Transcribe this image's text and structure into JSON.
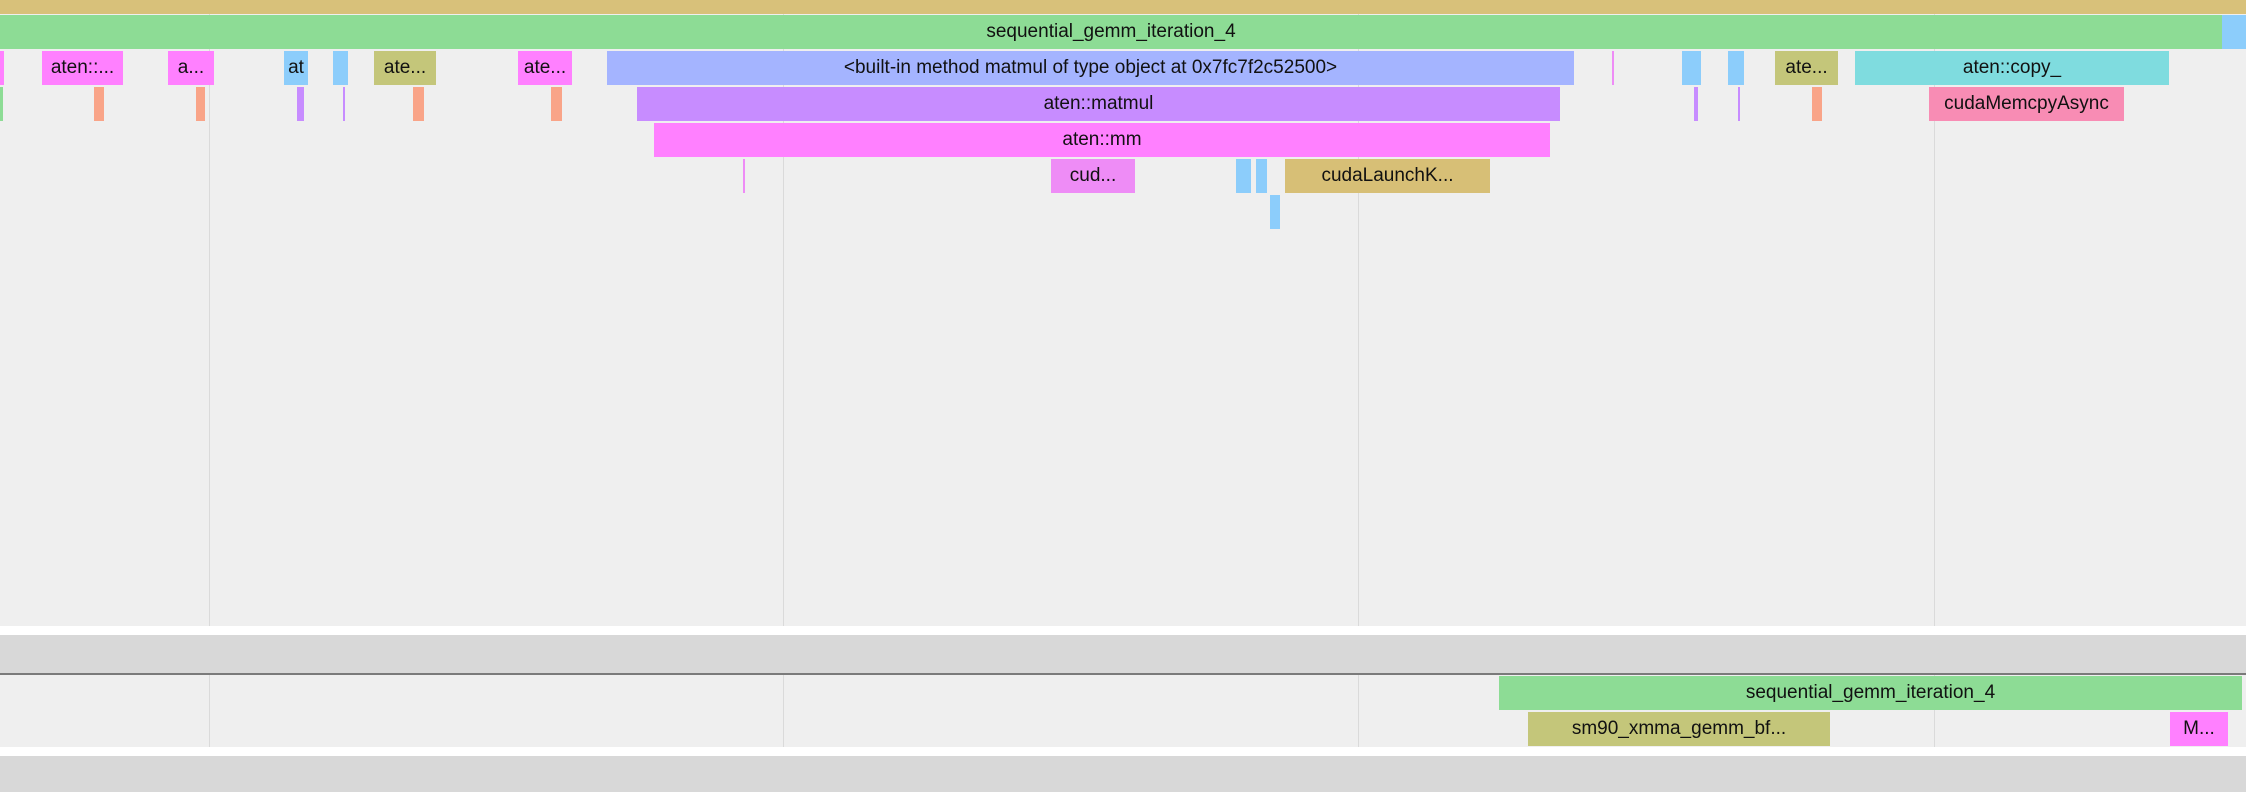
{
  "colors": {
    "background": "#efefef",
    "separator": "#d8d8d8",
    "divider_line": "#7a7a7a",
    "green": "#8ddc95",
    "tan_top": "#d8c17a",
    "pink": "#ff80ff",
    "violet": "#c78cff",
    "magenta_light": "#ee8cf6",
    "lavender_blue": "#a4b4ff",
    "sky": "#8ccdfb",
    "olive": "#c4c67a",
    "gold": "#d7bf76",
    "salmon": "#f9a488",
    "teal": "#7fdcdf",
    "rose": "#f88cb4"
  },
  "cpu_track": {
    "events": [
      {
        "name": "top-bar",
        "label": "",
        "color": "tan_top"
      },
      {
        "name": "sequential-gemm-iteration-4-bar",
        "label": "sequential_gemm_iteration_4",
        "color": "green"
      },
      {
        "name": "right-edge-sky-bar",
        "label": "",
        "color": "sky"
      },
      {
        "name": "left-edge-pink-bar",
        "label": "",
        "color": "pink"
      },
      {
        "name": "aten-bar-1",
        "label": "aten::...",
        "color": "pink"
      },
      {
        "name": "aten-bar-2",
        "label": "a...",
        "color": "pink"
      },
      {
        "name": "at-bar",
        "label": "at",
        "color": "sky"
      },
      {
        "name": "small-sky-bar-1",
        "label": "",
        "color": "sky"
      },
      {
        "name": "ate-bar-1",
        "label": "ate...",
        "color": "olive"
      },
      {
        "name": "ate-bar-2",
        "label": "ate...",
        "color": "pink"
      },
      {
        "name": "builtin-matmul-bar",
        "label": "<built-in method matmul of type object at 0x7fc7f2c52500>",
        "color": "lavender_blue"
      },
      {
        "name": "thin-magenta-tick-1",
        "label": "",
        "color": "magenta_light"
      },
      {
        "name": "small-sky-bar-2",
        "label": "",
        "color": "sky"
      },
      {
        "name": "small-sky-bar-3",
        "label": "",
        "color": "sky"
      },
      {
        "name": "ate-bar-3",
        "label": "ate...",
        "color": "olive"
      },
      {
        "name": "aten-copy-bar",
        "label": "aten::copy_",
        "color": "teal"
      },
      {
        "name": "green-tick-left",
        "label": "",
        "color": "green"
      },
      {
        "name": "salmon-tick-1",
        "label": "",
        "color": "salmon"
      },
      {
        "name": "salmon-tick-2",
        "label": "",
        "color": "salmon"
      },
      {
        "name": "violet-tick-1",
        "label": "",
        "color": "violet"
      },
      {
        "name": "violet-tick-2",
        "label": "",
        "color": "violet"
      },
      {
        "name": "salmon-tick-3",
        "label": "",
        "color": "salmon"
      },
      {
        "name": "salmon-tick-4",
        "label": "",
        "color": "salmon"
      },
      {
        "name": "aten-matmul-bar",
        "label": "aten::matmul",
        "color": "violet"
      },
      {
        "name": "violet-tick-3",
        "label": "",
        "color": "violet"
      },
      {
        "name": "violet-tick-4",
        "label": "",
        "color": "violet"
      },
      {
        "name": "salmon-tick-5",
        "label": "",
        "color": "salmon"
      },
      {
        "name": "cuda-memcpy-async-bar",
        "label": "cudaMemcpyAsync",
        "color": "rose"
      },
      {
        "name": "aten-mm-bar",
        "label": "aten::mm",
        "color": "pink"
      },
      {
        "name": "thin-magenta-tick-2",
        "label": "",
        "color": "magenta_light"
      },
      {
        "name": "cud-bar",
        "label": "cud...",
        "color": "magenta_light"
      },
      {
        "name": "small-sky-bar-4",
        "label": "",
        "color": "sky"
      },
      {
        "name": "small-sky-bar-5",
        "label": "",
        "color": "sky"
      },
      {
        "name": "cuda-launch-kernel-bar",
        "label": "cudaLaunchK...",
        "color": "gold"
      },
      {
        "name": "small-sky-bar-6",
        "label": "",
        "color": "sky"
      }
    ]
  },
  "gpu_track": {
    "events": [
      {
        "name": "gpu-sequential-gemm-iteration-4-bar",
        "label": "sequential_gemm_iteration_4",
        "color": "green"
      },
      {
        "name": "sm90-xmma-gemm-bar",
        "label": "sm90_xmma_gemm_bf...",
        "color": "olive"
      },
      {
        "name": "m-kernel-bar",
        "label": "M...",
        "color": "pink"
      }
    ]
  }
}
